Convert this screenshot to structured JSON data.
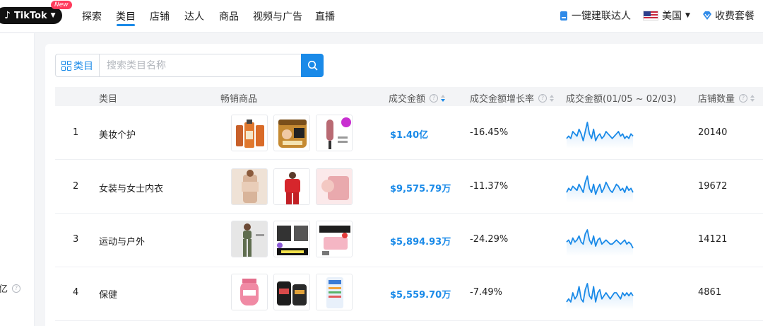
{
  "nav": {
    "logo_text": "TikTok",
    "logo_badge": "New",
    "items": [
      {
        "label": "探索"
      },
      {
        "label": "类目"
      },
      {
        "label": "店铺"
      },
      {
        "label": "达人"
      },
      {
        "label": "商品"
      },
      {
        "label": "视频与广告"
      },
      {
        "label": "直播"
      }
    ],
    "active_item": "类目",
    "connect_label": "一键建联达人",
    "region_label": "美国",
    "pricing_label": "收费套餐"
  },
  "sidebar": {
    "fragment_text": "亿"
  },
  "search": {
    "category_label": "类目",
    "placeholder": "搜索类目名称"
  },
  "table": {
    "columns": [
      {
        "label": "类目"
      },
      {
        "label": "畅销商品"
      },
      {
        "label": "成交金额"
      },
      {
        "label": "成交金额增长率"
      },
      {
        "label": "成交金额(01/05 ~ 02/03)"
      },
      {
        "label": "店铺数量"
      }
    ],
    "rows": [
      {
        "rank": "1",
        "category": "美妆个护",
        "amount": "$1.40亿",
        "growth": "-16.45%",
        "shops": "20140",
        "trend": [
          5,
          6,
          5,
          8,
          7,
          6,
          9,
          7,
          4,
          8,
          12,
          7,
          5,
          9,
          4,
          6,
          7,
          5,
          6,
          8,
          7,
          6,
          5,
          6,
          7,
          8,
          6,
          7,
          5,
          6,
          5,
          7,
          6
        ]
      },
      {
        "rank": "2",
        "category": "女装与女士内衣",
        "amount": "$9,575.79万",
        "growth": "-11.37%",
        "shops": "19672",
        "trend": [
          4,
          6,
          5,
          7,
          6,
          5,
          8,
          6,
          4,
          9,
          12,
          6,
          4,
          8,
          3,
          6,
          8,
          4,
          6,
          9,
          7,
          5,
          4,
          6,
          8,
          7,
          5,
          6,
          4,
          7,
          5,
          6,
          4
        ]
      },
      {
        "rank": "3",
        "category": "运动与户外",
        "amount": "$5,894.93万",
        "growth": "-24.29%",
        "shops": "14121",
        "trend": [
          6,
          7,
          5,
          8,
          6,
          7,
          9,
          6,
          5,
          10,
          12,
          7,
          5,
          9,
          4,
          7,
          8,
          5,
          6,
          7,
          6,
          5,
          5,
          6,
          7,
          6,
          5,
          6,
          7,
          5,
          6,
          5,
          3
        ]
      },
      {
        "rank": "4",
        "category": "保健",
        "amount": "$5,559.70万",
        "growth": "-7.49%",
        "shops": "4861",
        "trend": [
          5,
          6,
          5,
          8,
          6,
          7,
          10,
          6,
          5,
          9,
          11,
          7,
          6,
          10,
          5,
          8,
          9,
          6,
          7,
          8,
          7,
          6,
          7,
          8,
          8,
          7,
          6,
          8,
          7,
          8,
          7,
          8,
          7
        ]
      }
    ]
  },
  "colors": {
    "accent": "#1a8ae8",
    "badge": "#ff3b5c"
  }
}
